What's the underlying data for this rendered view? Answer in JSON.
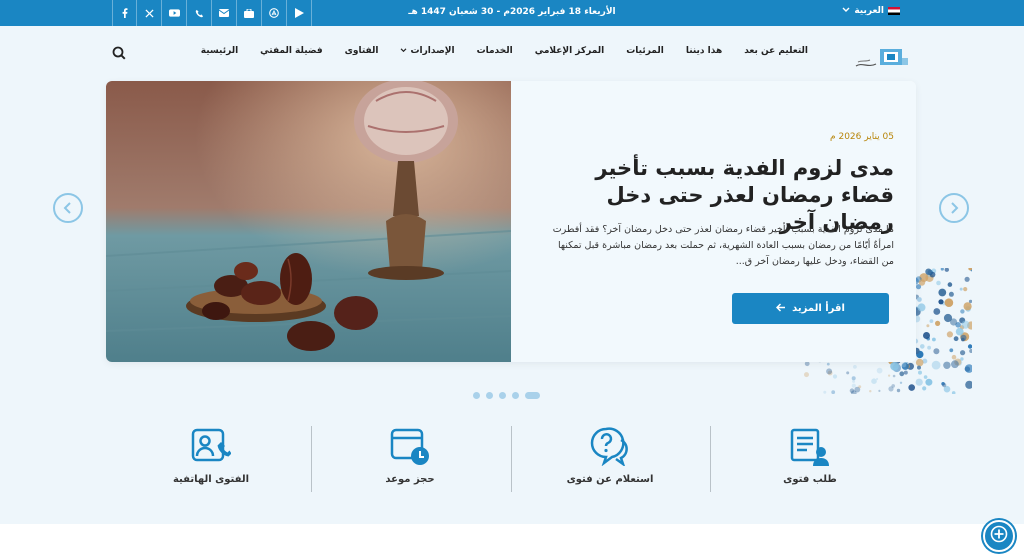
{
  "topbar": {
    "date": "الأربعاء 18 فبراير 2026م - 30 شعبان 1447 هـ",
    "language": "العربية",
    "social_icons": [
      "play-store-icon",
      "app-store-icon",
      "bag-icon",
      "mail-icon",
      "phone-icon",
      "youtube-icon",
      "x-icon",
      "facebook-icon"
    ]
  },
  "nav": {
    "items": [
      {
        "label": "الرئيسية"
      },
      {
        "label": "فضيلة المفتي"
      },
      {
        "label": "الفتاوى"
      },
      {
        "label": "الإصدارات",
        "dropdown": true
      },
      {
        "label": "الخدمات"
      },
      {
        "label": "المركز الإعلامي"
      },
      {
        "label": "المرئيات"
      },
      {
        "label": "هذا ديننا"
      },
      {
        "label": "التعليم عن بعد"
      }
    ]
  },
  "slide": {
    "date": "05 يناير 2026 م",
    "title": "مدى لزوم الفدية بسبب تأخير قضاء رمضان لعذر حتى دخل رمضان آخر",
    "excerpt": "ما مدى لزوم الفدية بسبب تأخير قضاء رمضان لعذر حتى دخل رمضان آخر؟ فقد أفطرت امرأةٌ أيّامًا من رمضان بسبب العادة الشهرية، ثم حملت بعد رمضان مباشرة قبل تمكنها من القضاء، ودخل عليها رمضان آخر ق...",
    "read_more": "اقرأ المزيد",
    "dots_count": 5,
    "active_dot": 4
  },
  "services": [
    {
      "label": "طلب فتوى",
      "icon": "fatwa-request-icon"
    },
    {
      "label": "استعلام عن فتوى",
      "icon": "fatwa-inquiry-icon"
    },
    {
      "label": "حجز موعد",
      "icon": "calendar-clock-icon"
    },
    {
      "label": "الفتوى الهاتفية",
      "icon": "phone-fatwa-icon"
    }
  ],
  "colors": {
    "primary": "#1a86c3",
    "background": "#eef6fb",
    "date_accent": "#b8860b"
  }
}
